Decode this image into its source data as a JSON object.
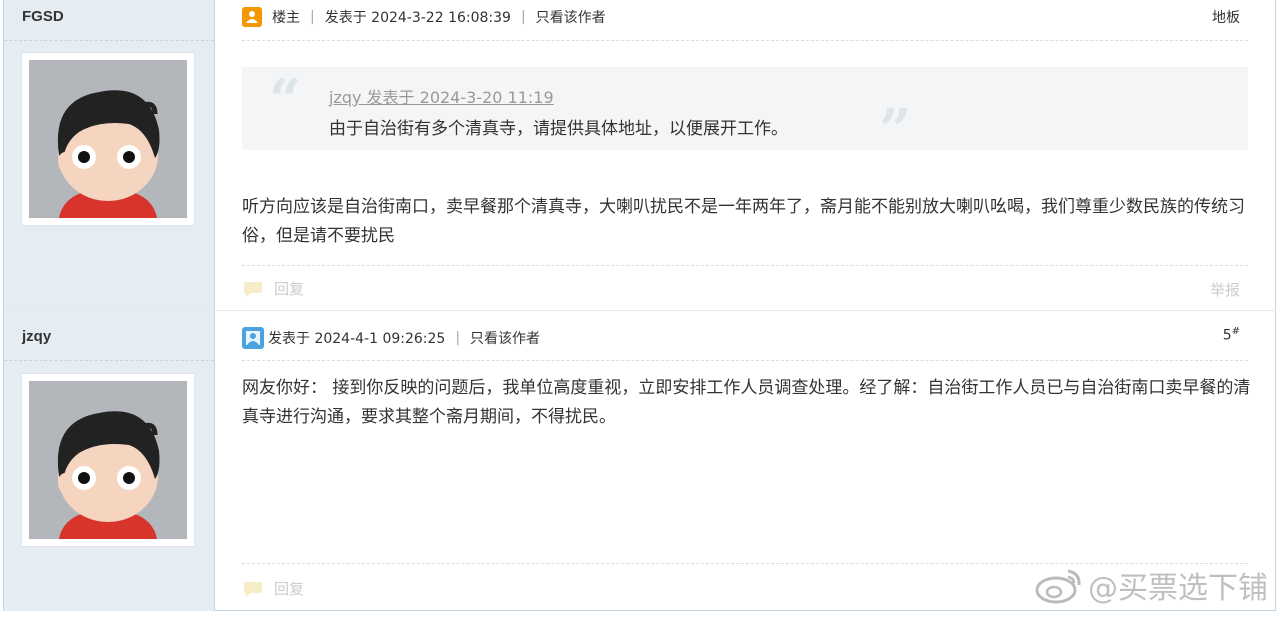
{
  "posts": [
    {
      "author": "FGSD",
      "role_label": "楼主",
      "posted_at": "发表于 2024-3-22 16:08:39",
      "only_author": "只看该作者",
      "floor": "地板",
      "quote": {
        "link": "jzqy 发表于 2024-3-20 11:19",
        "text": "由于自治街有多个清真寺，请提供具体地址，以便展开工作。"
      },
      "body": "听方向应该是自治街南口，卖早餐那个清真寺，大喇叭扰民不是一年两年了，斋月能不能别放大喇叭吆喝，我们尊重少数民族的传统习俗，但是请不要扰民",
      "reply": "回复",
      "report": "举报"
    },
    {
      "author": "jzqy",
      "posted_at": "发表于 2024-4-1 09:26:25",
      "only_author": "只看该作者",
      "floor": "5",
      "floor_suffix": "#",
      "body": "网友你好： 接到你反映的问题后，我单位高度重视，立即安排工作人员调查处理。经了解：自治街工作人员已与自治街南口卖早餐的清真寺进行沟通，要求其整个斋月期间，不得扰民。",
      "reply": "回复"
    }
  ],
  "watermark": "@买票选下铺",
  "colors": {
    "sidebar_bg": "#e5edf2",
    "border": "#c2d5e3",
    "quote_bg": "#f3f5f7",
    "owner_icon": "#f39800",
    "user_icon": "#4aa3df"
  },
  "icons": {
    "owner": "owner-badge-icon",
    "user": "user-profile-icon",
    "reply": "reply-bubble-icon",
    "weibo": "weibo-logo-icon"
  }
}
